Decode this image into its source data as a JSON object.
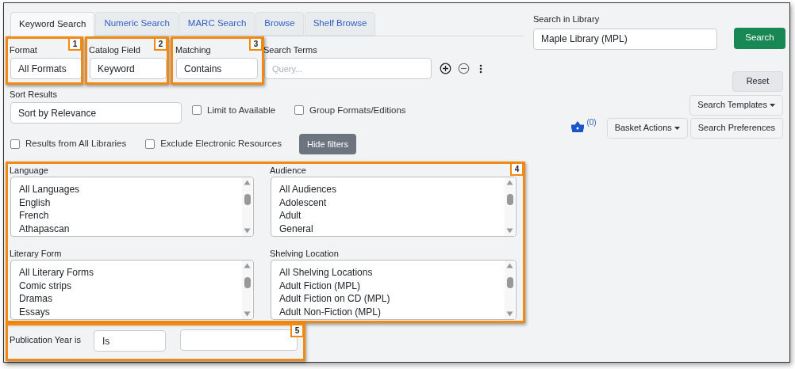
{
  "tabs": [
    {
      "label": "Keyword Search",
      "selected": true
    },
    {
      "label": "Numeric Search",
      "selected": false
    },
    {
      "label": "MARC Search",
      "selected": false
    },
    {
      "label": "Browse",
      "selected": false
    },
    {
      "label": "Shelf Browse",
      "selected": false
    }
  ],
  "library": {
    "label": "Search in Library",
    "value": "Maple Library (MPL)",
    "button": "Search"
  },
  "search_row": [
    {
      "label": "Format",
      "value": "All Formats"
    },
    {
      "label": "Catalog Field",
      "value": "Keyword"
    },
    {
      "label": "Matching",
      "value": "Contains"
    },
    {
      "label": "Search Terms",
      "placeholder": "Query..."
    }
  ],
  "sort": {
    "label": "Sort Results",
    "value": "Sort by Relevance"
  },
  "options_row_1": [
    {
      "label": "Limit to Available",
      "checked": false
    },
    {
      "label": "Group Formats/Editions",
      "checked": false
    }
  ],
  "options_row_2": [
    {
      "label": "Results from All Libraries",
      "checked": false
    },
    {
      "label": "Exclude Electronic Resources",
      "checked": false
    }
  ],
  "hide_filters": "Hide filters",
  "actions": {
    "reset": "Reset",
    "templates": "Search Templates",
    "basket_count": "(0)",
    "basket": "Basket Actions",
    "preferences": "Search Preferences"
  },
  "filters": [
    {
      "label": "Language",
      "items": [
        "All Languages",
        "English",
        "French",
        "Athapascan"
      ]
    },
    {
      "label": "Audience",
      "items": [
        "All Audiences",
        "Adolescent",
        "Adult",
        "General"
      ]
    },
    {
      "label": "Literary Form",
      "items": [
        "All Literary Forms",
        "Comic strips",
        "Dramas",
        "Essays"
      ]
    },
    {
      "label": "Shelving Location",
      "items": [
        "All Shelving Locations",
        "Adult Fiction (MPL)",
        "Adult Fiction on CD (MPL)",
        "Adult Non-Fiction (MPL)"
      ]
    }
  ],
  "publication_year": {
    "label": "Publication Year is",
    "operator": "Is"
  },
  "callouts": [
    "1",
    "2",
    "3",
    "4",
    "5"
  ]
}
